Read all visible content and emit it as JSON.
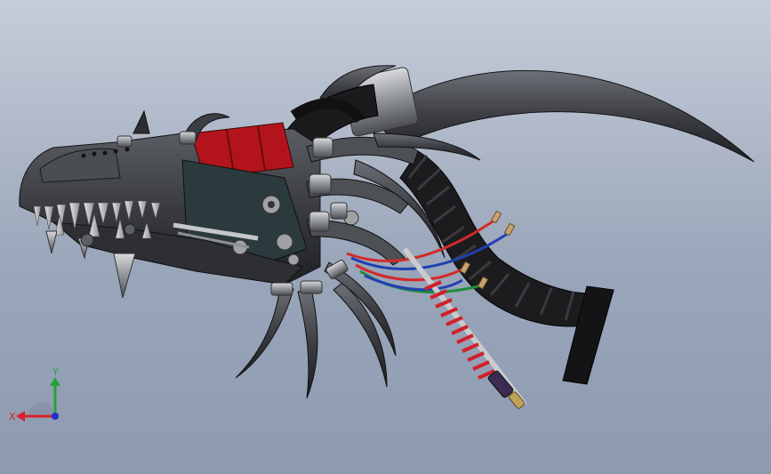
{
  "view_triad": {
    "y_label": "Y",
    "x_label": "X",
    "y_color": "#21a33b",
    "x_color": "#d8212a",
    "z_color": "#2130c8"
  },
  "model_colors": {
    "body_dark": "#3a3c40",
    "body_mid": "#55585e",
    "accent_red": "#b3141b",
    "spring_red": "#d0202a",
    "wire_red": "#d22a2a",
    "wire_blue": "#2040b0",
    "wire_green": "#1f8c3a"
  }
}
